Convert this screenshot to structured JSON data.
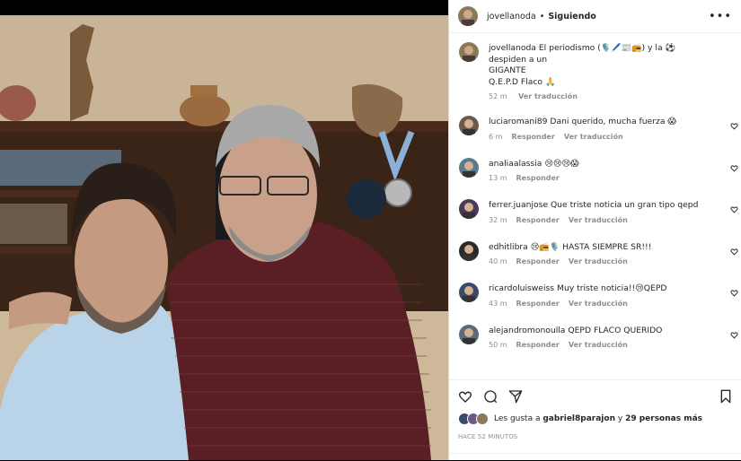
{
  "post": {
    "username": "jovellanoda",
    "separator": "•",
    "follow_status": "Siguiendo",
    "more_label": "•••"
  },
  "caption": {
    "username": "jovellanoda",
    "line1": "El periodismo (🎙️🖊️📰📻) y la ⚽ despiden a un",
    "line2": "GIGANTE",
    "line3": "Q.E.P.D Flaco 🙏",
    "time": "52 m",
    "translate": "Ver traducción"
  },
  "comments": [
    {
      "username": "luciaromani89",
      "text": "Dani querido, mucha fuerza 😱",
      "time": "6 m",
      "reply": "Responder",
      "translate": "Ver traducción",
      "avatar_color": "#6b5a4a"
    },
    {
      "username": "analiaalassia",
      "text": "😢😢😢😱",
      "time": "13 m",
      "reply": "Responder",
      "translate": "",
      "avatar_color": "#5a7a8a"
    },
    {
      "username": "ferrer.juanjose",
      "text": "Que triste noticia un gran tipo qepd",
      "time": "32 m",
      "reply": "Responder",
      "translate": "Ver traducción",
      "avatar_color": "#4a3a5a"
    },
    {
      "username": "edhitlibra",
      "text": "😢📻🎙️ HASTA SIEMPRE SR!!!",
      "time": "40 m",
      "reply": "Responder",
      "translate": "Ver traducción",
      "avatar_color": "#2a2a2a"
    },
    {
      "username": "ricardoluisweiss",
      "text": "Muy triste noticia!!😢QEPD",
      "time": "43 m",
      "reply": "Responder",
      "translate": "Ver traducción",
      "avatar_color": "#3a4a6a"
    },
    {
      "username": "alejandromonoulla",
      "text": "QEPD FLACO QUERIDO",
      "time": "50 m",
      "reply": "Responder",
      "translate": "Ver traducción",
      "avatar_color": "#5a6a7a"
    }
  ],
  "likes": {
    "prefix": "Les gusta a",
    "user": "gabriel8parajon",
    "middle": "y",
    "count": "29 personas más"
  },
  "timestamp": "HACE 52 MINUTOS",
  "icons": [
    "heart-icon",
    "comment-icon",
    "share-icon",
    "bookmark-icon"
  ]
}
